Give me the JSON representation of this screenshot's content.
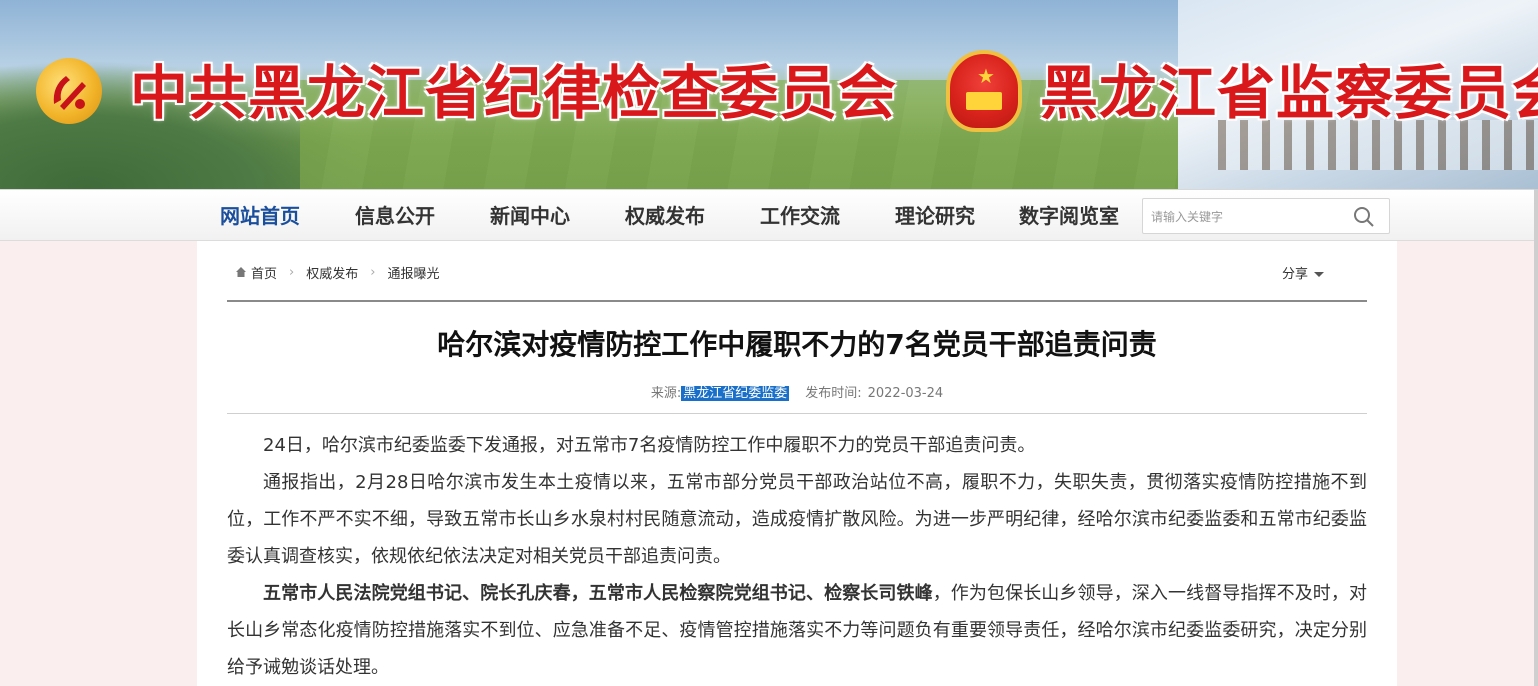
{
  "banner": {
    "title_left": "中共黑龙江省纪律检查委员会",
    "title_right": "黑龙江省监察委员会",
    "title_color": "#d8181a"
  },
  "nav": {
    "items": [
      "网站首页",
      "信息公开",
      "新闻中心",
      "权威发布",
      "工作交流",
      "理论研究",
      "数字阅览室"
    ],
    "active_color": "#1b4f9c",
    "search_placeholder": "请输入关键字"
  },
  "breadcrumb": {
    "items": [
      "首页",
      "权威发布",
      "通报曝光"
    ],
    "share_label": "分享"
  },
  "article": {
    "title": "哈尔滨对疫情防控工作中履职不力的7名党员干部追责问责",
    "source_label": "来源:",
    "source_value": "黑龙江省纪委监委",
    "date_label": "发布时间:",
    "date_value": "2022-03-24",
    "paragraphs": [
      {
        "text": "24日，哈尔滨市纪委监委下发通报，对五常市7名疫情防控工作中履职不力的党员干部追责问责。"
      },
      {
        "text": "通报指出，2月28日哈尔滨市发生本土疫情以来，五常市部分党员干部政治站位不高，履职不力，失职失责，贯彻落实疫情防控措施不到位，工作不严不实不细，导致五常市长山乡水泉村村民随意流动，造成疫情扩散风险。为进一步严明纪律，经哈尔滨市纪委监委和五常市纪委监委认真调查核实，依规依纪依法决定对相关党员干部追责问责。"
      },
      {
        "bold": "五常市人民法院党组书记、院长孔庆春，五常市人民检察院党组书记、检察长司铁峰",
        "text": "，作为包保长山乡领导，深入一线督导指挥不及时，对长山乡常态化疫情防控措施落实不到位、应急准备不足、疫情管控措施落实不力等问题负有重要领导责任，经哈尔滨市纪委监委研究，决定分别给予诫勉谈话处理。"
      }
    ]
  }
}
